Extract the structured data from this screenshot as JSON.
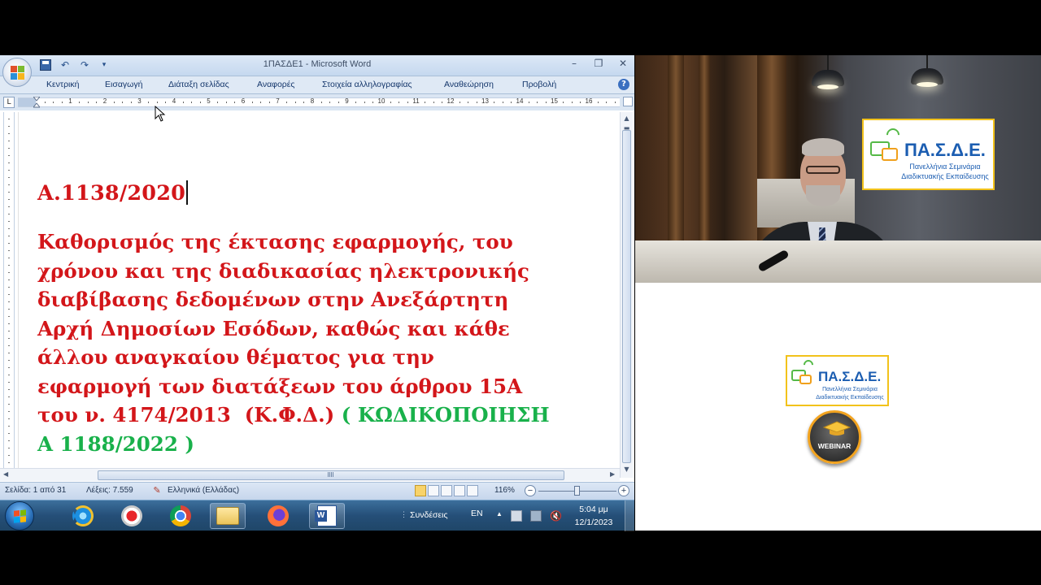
{
  "window": {
    "title": "1ΠΑΣΔΕ1 - Microsoft Word",
    "controls": {
      "minimize": "–",
      "restore": "❐",
      "close": "✕"
    }
  },
  "ribbon": {
    "tabs": [
      "Κεντρική",
      "Εισαγωγή",
      "Διάταξη σελίδας",
      "Αναφορές",
      "Στοιχεία αλληλογραφίας",
      "Αναθεώρηση",
      "Προβολή"
    ],
    "help": "?"
  },
  "ruler": {
    "corner_glyph": "L",
    "numbers": [
      "1",
      "2",
      "3",
      "4",
      "5",
      "6",
      "7",
      "8",
      "9",
      "10",
      "11",
      "12",
      "13",
      "14",
      "15",
      "16"
    ]
  },
  "document": {
    "heading": "Α.1138/2020",
    "body_lines": [
      "Καθορισμός της έκτασης εφαρμογής, του",
      "χρόνου και της διαδικασίας ηλεκτρονικής",
      "διαβίβασης δεδομένων στην Ανεξάρτητη",
      "Αρχή Δημοσίων Εσόδων, καθώς και κάθε",
      "άλλου αναγκαίου θέματος για την",
      "εφαρμογή των διατάξεων του άρθρου 15Α"
    ],
    "last_line_red": "του ν. 4174/2013  (Κ.Φ.Δ.) ",
    "last_line_green": "( ΚΩΔΙΚΟΠΟΙΗΣΗ",
    "final_line_green": "Α 1188/2022 )"
  },
  "statusbar": {
    "page": "Σελίδα: 1 από 31",
    "words": "Λέξεις: 7.559",
    "language": "Ελληνικά (Ελλάδας)",
    "zoom": "116%",
    "zoom_minus": "−",
    "zoom_plus": "+"
  },
  "taskbar": {
    "apps": [
      "start-menu",
      "internet-explorer",
      "screen-recorder",
      "google-chrome",
      "windows-explorer",
      "firefox",
      "microsoft-word"
    ],
    "connections_label": "Συνδέσεις",
    "language": "EN",
    "time": "5:04 μμ",
    "date": "12/1/2023"
  },
  "logos": {
    "brand_name": "ΠΑ.Σ.Δ.Ε.",
    "brand_sub_line1": "Πανελλήνια Σεμινάρια",
    "brand_sub_line2": "Διαδικτυακής Εκπαίδευσης",
    "webinar_label": "WEBINAR"
  },
  "colors": {
    "document_red": "#d3161a",
    "document_green": "#19b14b",
    "brand_blue": "#1b5db1",
    "brand_gold": "#f2c21b"
  }
}
